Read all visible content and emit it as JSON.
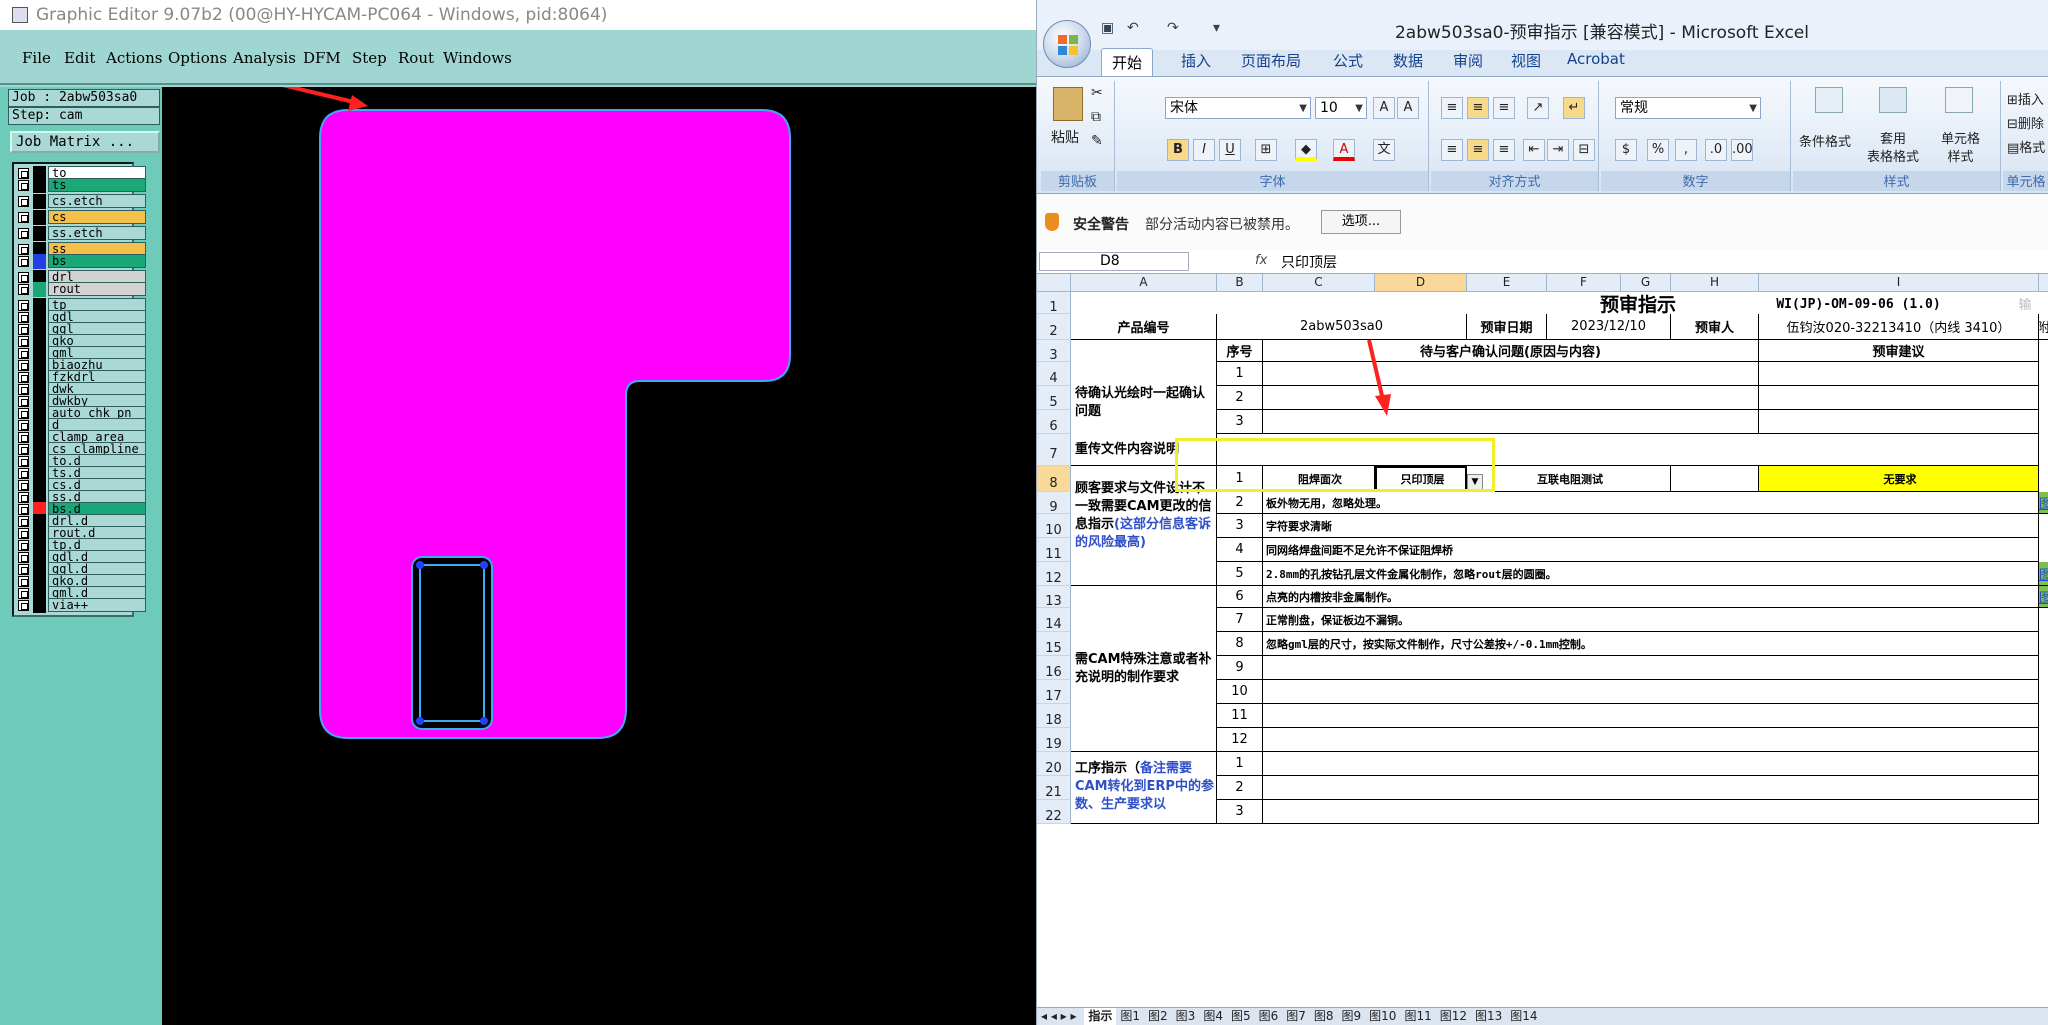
{
  "graphic_editor": {
    "title": "Graphic Editor 9.07b2 (00@HY-HYCAM-PC064 - Windows, pid:8064)",
    "menu": [
      "File",
      "Edit",
      "Actions",
      "Options",
      "Analysis",
      "DFM",
      "Step",
      "Rout",
      "Windows"
    ],
    "job_label": "Job : 2abw503sa0",
    "step_label": "Step: cam",
    "job_matrix_button": "Job Matrix ...",
    "layers": [
      {
        "name": "to",
        "color": "#000000",
        "highlight": "#ffffff"
      },
      {
        "name": "ts",
        "color": "#000000",
        "highlight": "#1aa879"
      },
      {
        "name": "cs.etch",
        "color": "#000000",
        "highlight": ""
      },
      {
        "name": "cs",
        "color": "#000000",
        "highlight": "#f5c04a"
      },
      {
        "name": "ss.etch",
        "color": "#000000",
        "highlight": ""
      },
      {
        "name": "ss",
        "color": "#000000",
        "highlight": "#f5c04a"
      },
      {
        "name": "bs",
        "color": "#2040e0",
        "highlight": "#1aa879"
      },
      {
        "name": "drl",
        "color": "#000000",
        "highlight": "#d2d2d2"
      },
      {
        "name": "rout",
        "color": "#1aa879",
        "highlight": "#d2d2d2"
      },
      {
        "name": "tp",
        "color": "#000000",
        "highlight": ""
      },
      {
        "name": "gdl",
        "color": "#000000",
        "highlight": ""
      },
      {
        "name": "ggl",
        "color": "#000000",
        "highlight": ""
      },
      {
        "name": "gko",
        "color": "#000000",
        "highlight": ""
      },
      {
        "name": "gml",
        "color": "#000000",
        "highlight": ""
      },
      {
        "name": "biaozhu",
        "color": "#000000",
        "highlight": ""
      },
      {
        "name": "fzkdrl",
        "color": "#000000",
        "highlight": ""
      },
      {
        "name": "dwk",
        "color": "#000000",
        "highlight": ""
      },
      {
        "name": "dwkby",
        "color": "#000000",
        "highlight": ""
      },
      {
        "name": "auto_chk_pn",
        "color": "#000000",
        "highlight": ""
      },
      {
        "name": "d",
        "color": "#000000",
        "highlight": ""
      },
      {
        "name": "clamp_area",
        "color": "#000000",
        "highlight": ""
      },
      {
        "name": "cs_clampline",
        "color": "#000000",
        "highlight": ""
      },
      {
        "name": "to.d",
        "color": "#000000",
        "highlight": ""
      },
      {
        "name": "ts.d",
        "color": "#000000",
        "highlight": ""
      },
      {
        "name": "cs.d",
        "color": "#000000",
        "highlight": ""
      },
      {
        "name": "ss.d",
        "color": "#000000",
        "highlight": ""
      },
      {
        "name": "bs.d",
        "color": "#ff2020",
        "highlight": "#1aa879"
      },
      {
        "name": "drl.d",
        "color": "#000000",
        "highlight": ""
      },
      {
        "name": "rout.d",
        "color": "#000000",
        "highlight": ""
      },
      {
        "name": "tp.d",
        "color": "#000000",
        "highlight": ""
      },
      {
        "name": "gdl.d",
        "color": "#000000",
        "highlight": ""
      },
      {
        "name": "ggl.d",
        "color": "#000000",
        "highlight": ""
      },
      {
        "name": "gko.d",
        "color": "#000000",
        "highlight": ""
      },
      {
        "name": "gml.d",
        "color": "#000000",
        "highlight": ""
      },
      {
        "name": "via++",
        "color": "#000000",
        "highlight": ""
      }
    ],
    "board_fill": "#ff00ff",
    "outline_color": "#3fa9f5"
  },
  "excel": {
    "title": "2abw503sa0-预审指示  [兼容模式] - Microsoft Excel",
    "tabs": [
      "开始",
      "插入",
      "页面布局",
      "公式",
      "数据",
      "审阅",
      "视图",
      "Acrobat"
    ],
    "clipboard": {
      "paste": "粘贴",
      "label": "剪贴板"
    },
    "font": {
      "name": "宋体",
      "size": "10",
      "label": "字体"
    },
    "align_label": "对齐方式",
    "number": {
      "format": "常规",
      "label": "数字"
    },
    "styles": {
      "cond": "条件格式",
      "table": "套用\n表格格式",
      "cell": "单元格\n样式",
      "label": "样式"
    },
    "cells_group": {
      "insert": "插入",
      "delete": "删除",
      "format": "格式",
      "label": "单元格"
    },
    "security": {
      "title": "安全警告",
      "message": "部分活动内容已被禁用。",
      "options": "选项..."
    },
    "name_box": "D8",
    "formula_value": "只印顶层",
    "columns": [
      "A",
      "B",
      "C",
      "D",
      "E",
      "F",
      "G",
      "H",
      "I"
    ],
    "rows": [
      "1",
      "2",
      "3",
      "4",
      "5",
      "6",
      "7",
      "8",
      "9",
      "10",
      "11",
      "12",
      "13",
      "14",
      "15",
      "16",
      "17",
      "18",
      "19",
      "20",
      "21",
      "22"
    ],
    "sheet": {
      "title": "预审指示",
      "doc_code": "WI(JP)-OM-09-06 (1.0)",
      "product_no_label": "产品编号",
      "product_no": "2abw503sa0",
      "date_label": "预审日期",
      "date": "2023/12/10",
      "reviewer_label": "预审人",
      "reviewer": "伍钧汝020-32213410（内线 3410）",
      "seq_label": "序号",
      "issue_label": "待与客户确认问题(原因与内容)",
      "suggest_label": "预审建议",
      "section1": "待确认光绘时一起确认问题",
      "section2": "重传文件内容说明",
      "section3": "顾客要求与文件设计不一致需要CAM更改的信息指示",
      "section3_note": "(这部分信息客诉的风险最高)",
      "section4": "需CAM特殊注意或者补充说明的制作要求",
      "section5": "工序指示（",
      "section5_note": "备注需要CAM转化到ERP中的参数、生产要求以",
      "right_partial": "附",
      "extra_partial": "输",
      "row8": {
        "seq": "1",
        "c": "阻焊面次",
        "d": "只印顶层",
        "ef": "互联电阻测试",
        "i": "无要求"
      },
      "notes": [
        {
          "seq": "2",
          "text": "板外物无用，忽略处理。",
          "link": "图1!A1"
        },
        {
          "seq": "3",
          "text": "字符要求清晰",
          "link": ""
        },
        {
          "seq": "4",
          "text": "同网络焊盘间距不足允许不保证阻焊桥",
          "link": ""
        },
        {
          "seq": "5",
          "text": "2.8mm的孔按钻孔层文件金属化制作，忽略rout层的圆圈。",
          "link": "图2!A1"
        },
        {
          "seq": "6",
          "text": "点亮的内槽按非金属制作。",
          "link": "图3!A1"
        },
        {
          "seq": "7",
          "text": "正常削盘，保证板边不漏铜。",
          "link": ""
        },
        {
          "seq": "8",
          "text": "忽略gml层的尺寸，按实际文件制作，尺寸公差按+/-0.1mm控制。",
          "link": ""
        },
        {
          "seq": "9",
          "text": "",
          "link": ""
        },
        {
          "seq": "10",
          "text": "",
          "link": ""
        },
        {
          "seq": "11",
          "text": "",
          "link": ""
        },
        {
          "seq": "12",
          "text": "",
          "link": ""
        }
      ],
      "seq_top": [
        "1",
        "2",
        "3"
      ],
      "seq_bottom": [
        "1",
        "2",
        "3"
      ]
    },
    "sheet_tabs": [
      "指示",
      "图1",
      "图2",
      "图3",
      "图4",
      "图5",
      "图6",
      "图7",
      "图8",
      "图9",
      "图10",
      "图11",
      "图12",
      "图13",
      "图14"
    ]
  }
}
